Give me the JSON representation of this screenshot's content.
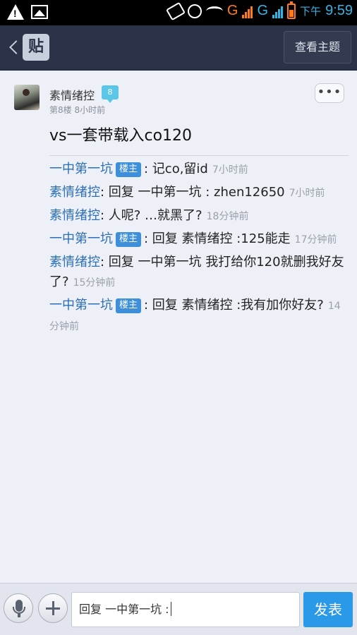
{
  "status_bar": {
    "network_g1": "G",
    "network_g2": "G",
    "time_prefix": "下午",
    "time": "9:59"
  },
  "header": {
    "logo_text": "贴",
    "topic_button": "查看主题"
  },
  "post": {
    "author": "素情绪控",
    "level": "8",
    "floor_info": "第8楼  8小时前",
    "more_button": "•••",
    "content": "vs一套带载入co120"
  },
  "replies": [
    {
      "name": "一中第一坑",
      "badge": "楼主",
      "text": ": 记co,留id",
      "time": "7小时前"
    },
    {
      "name": "素情绪控",
      "badge": "",
      "text": ": 回复 一中第一坑 : zhen12650",
      "time": "7小时前"
    },
    {
      "name": "素情绪控",
      "badge": "",
      "text": ": 人呢? …就黑了?",
      "time": "18分钟前"
    },
    {
      "name": "一中第一坑",
      "badge": "楼主",
      "text": ": 回复 素情绪控 :125能走",
      "time": "17分钟前"
    },
    {
      "name": "素情绪控",
      "badge": "",
      "text": ": 回复 一中第一坑 我打给你120就删我好友了?",
      "time": "15分钟前"
    },
    {
      "name": "一中第一坑",
      "badge": "楼主",
      "text": ": 回复 素情绪控 :我有加你好友?",
      "time": "14分钟前"
    }
  ],
  "bottom_bar": {
    "input_value": "回复 一中第一坑 :",
    "send_button": "发表"
  },
  "colors": {
    "accent": "#2a9ae8",
    "header_bg": "#2a3347",
    "name_link": "#2b6fb8",
    "owner_badge": "#3e8fd9"
  }
}
